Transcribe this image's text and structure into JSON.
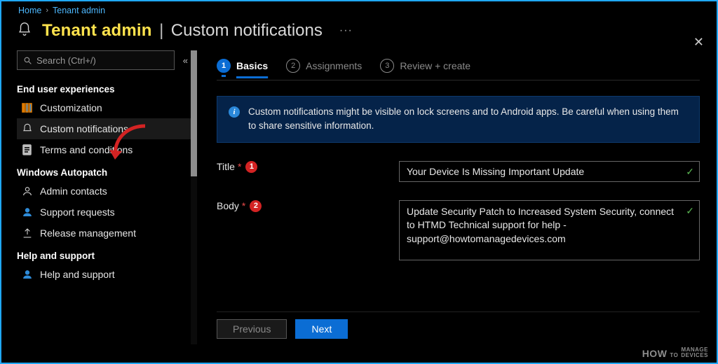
{
  "breadcrumb": {
    "home": "Home",
    "tenant": "Tenant admin"
  },
  "header": {
    "title": "Tenant admin",
    "subtitle": "Custom notifications",
    "more": "···"
  },
  "search": {
    "placeholder": "Search (Ctrl+/)"
  },
  "sidebar": {
    "groups": {
      "eux": "End user experiences",
      "wap": "Windows Autopatch",
      "help": "Help and support"
    },
    "items": {
      "customization": "Customization",
      "custom_notifications": "Custom notifications",
      "terms": "Terms and conditions",
      "admin_contacts": "Admin contacts",
      "support_requests": "Support requests",
      "release_mgmt": "Release management",
      "help_support": "Help and support"
    }
  },
  "wizard": {
    "steps": {
      "s1": "Basics",
      "s2": "Assignments",
      "s3": "Review + create",
      "n1": "1",
      "n2": "2",
      "n3": "3"
    }
  },
  "banner": {
    "text": "Custom notifications might be visible on lock screens and to Android apps.  Be careful when using them to share sensitive information."
  },
  "form": {
    "title_label": "Title",
    "body_label": "Body",
    "badges": {
      "b1": "1",
      "b2": "2"
    },
    "title_value": "Your Device Is Missing Important Update",
    "body_value": "Update Security Patch to Increased System Security, connect to HTMD Technical support for help - support@howtomanagedevices.com"
  },
  "footer": {
    "prev": "Previous",
    "next": "Next"
  },
  "watermark": {
    "a": "HOW",
    "b": "TO",
    "c": "MANAGE",
    "d": "DEVICES"
  }
}
